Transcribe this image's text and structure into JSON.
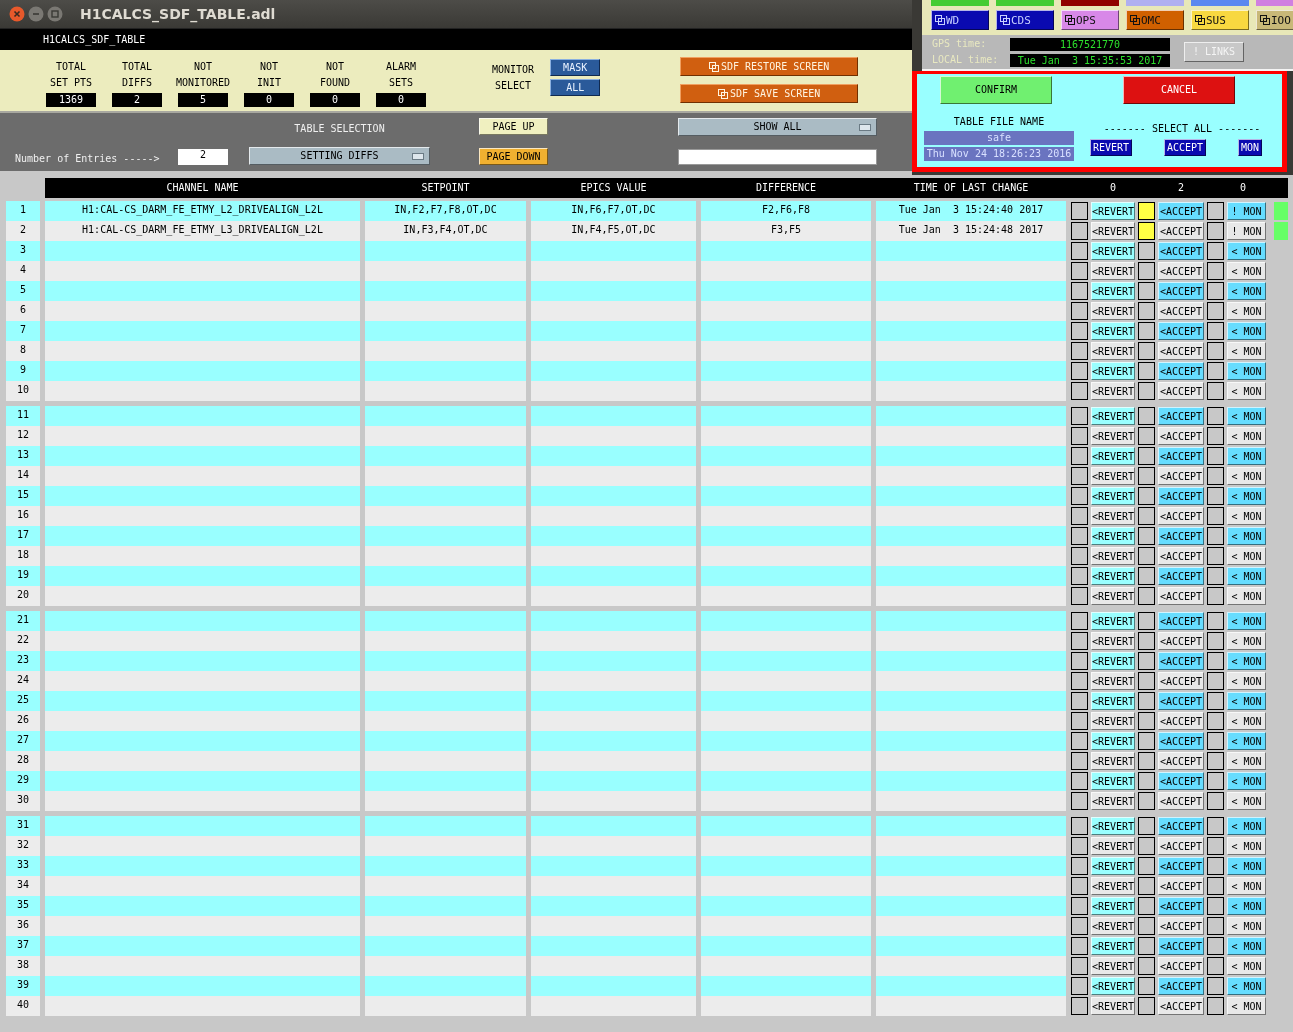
{
  "window": {
    "title": "H1CALCS_SDF_TABLE.adl"
  },
  "screen_title": "H1CALCS_SDF_TABLE",
  "stats": [
    {
      "label": [
        "TOTAL",
        "SET PTS"
      ],
      "value": "1369"
    },
    {
      "label": [
        "TOTAL",
        "DIFFS"
      ],
      "value": "2"
    },
    {
      "label": [
        "NOT",
        "MONITORED"
      ],
      "value": "5"
    },
    {
      "label": [
        "NOT",
        "INIT"
      ],
      "value": "0"
    },
    {
      "label": [
        "NOT",
        "FOUND"
      ],
      "value": "0"
    },
    {
      "label": [
        "ALARM",
        "SETS"
      ],
      "value": "0"
    }
  ],
  "monitor_select": {
    "label": [
      "MONITOR",
      "SELECT"
    ],
    "buttons": [
      "MASK",
      "ALL"
    ]
  },
  "sdf_buttons": [
    "SDF RESTORE SCREEN",
    "SDF SAVE SCREEN"
  ],
  "entries": {
    "label": "Number of Entries ----->",
    "value": "2"
  },
  "table_selection": {
    "label": "TABLE SELECTION",
    "value": "SETTING DIFFS"
  },
  "paging": [
    {
      "label": "PAGE UP",
      "kind": "up"
    },
    {
      "label": "PAGE DOWN",
      "kind": "down"
    }
  ],
  "show_menu": {
    "value": "SHOW ALL"
  },
  "displays": {
    "cut_buttons": [
      {
        "color": "#44cc33"
      },
      {
        "color": "#44cc33"
      },
      {
        "color": "#900000"
      },
      {
        "color": "#b0b0f0"
      },
      {
        "color": "#5a88f0"
      },
      {
        "color": "#d080e0"
      }
    ],
    "buttons": [
      {
        "label": "WD",
        "color": "#0a0ab0"
      },
      {
        "label": "CDS",
        "color": "#0a0ab0"
      },
      {
        "label": "OPS",
        "color": "#d888e8"
      },
      {
        "label": "OMC",
        "color": "#d06000"
      },
      {
        "label": "SUS",
        "color": "#f8d840"
      },
      {
        "label": "IOO",
        "color": "#c8b878"
      }
    ]
  },
  "gps_time": {
    "label": "GPS time:",
    "value": "1167521770"
  },
  "local_time": {
    "label": "LOCAL time:",
    "value": "Tue Jan  3 15:35:53 2017"
  },
  "links_button": "! LINKS",
  "confirm_button": "CONFIRM",
  "cancel_button": "CANCEL",
  "table_file": {
    "label": "TABLE FILE NAME",
    "name": "safe",
    "date": "Thu Nov 24 18:26:23 2016"
  },
  "select_all": {
    "label": "------- SELECT ALL -------",
    "buttons": [
      "REVERT",
      "ACCEPT",
      "MON"
    ]
  },
  "table": {
    "columns": [
      "CHANNEL NAME",
      "SETPOINT",
      "EPICS VALUE",
      "DIFFERENCE",
      "TIME OF LAST CHANGE"
    ],
    "counts": [
      "0",
      "2",
      "0"
    ],
    "rows": [
      {
        "number": "1",
        "channel": "H1:CAL-CS_DARM_FE_ETMY_L2_DRIVEALIGN_L2L",
        "setpoint": "IN,F2,F7,F8,OT,DC",
        "epics_value": "IN,F6,F7,OT,DC",
        "difference": "F2,F6,F8",
        "time": "Tue Jan  3 15:24:40 2017",
        "revert": {
          "label": "<REVERT",
          "checked": false
        },
        "accept": {
          "label": "<ACCEPT",
          "checked": true
        },
        "mon": {
          "label": "! MON",
          "checked": false
        },
        "changed": true
      },
      {
        "number": "2",
        "channel": "H1:CAL-CS_DARM_FE_ETMY_L3_DRIVEALIGN_L2L",
        "setpoint": "IN,F3,F4,OT,DC",
        "epics_value": "IN,F4,F5,OT,DC",
        "difference": "F3,F5",
        "time": "Tue Jan  3 15:24:48 2017",
        "revert": {
          "label": "<REVERT",
          "checked": false
        },
        "accept": {
          "label": "<ACCEPT",
          "checked": true
        },
        "mon": {
          "label": "! MON",
          "checked": false
        },
        "changed": true
      },
      {
        "number": "3",
        "revert": {
          "label": "<REVERT",
          "checked": false
        },
        "accept": {
          "label": "<ACCEPT",
          "checked": false
        },
        "mon": {
          "label": "< MON",
          "checked": false
        },
        "changed": false
      },
      {
        "number": "4",
        "revert": {
          "label": "<REVERT",
          "checked": false
        },
        "accept": {
          "label": "<ACCEPT",
          "checked": false
        },
        "mon": {
          "label": "< MON",
          "checked": false
        },
        "changed": false
      },
      {
        "number": "5",
        "revert": {
          "label": "<REVERT",
          "checked": false
        },
        "accept": {
          "label": "<ACCEPT",
          "checked": false
        },
        "mon": {
          "label": "< MON",
          "checked": false
        },
        "changed": false
      },
      {
        "number": "6",
        "revert": {
          "label": "<REVERT",
          "checked": false
        },
        "accept": {
          "label": "<ACCEPT",
          "checked": false
        },
        "mon": {
          "label": "< MON",
          "checked": false
        },
        "changed": false
      },
      {
        "number": "7",
        "revert": {
          "label": "<REVERT",
          "checked": false
        },
        "accept": {
          "label": "<ACCEPT",
          "checked": false
        },
        "mon": {
          "label": "< MON",
          "checked": false
        },
        "changed": false
      },
      {
        "number": "8",
        "revert": {
          "label": "<REVERT",
          "checked": false
        },
        "accept": {
          "label": "<ACCEPT",
          "checked": false
        },
        "mon": {
          "label": "< MON",
          "checked": false
        },
        "changed": false
      },
      {
        "number": "9",
        "revert": {
          "label": "<REVERT",
          "checked": false
        },
        "accept": {
          "label": "<ACCEPT",
          "checked": false
        },
        "mon": {
          "label": "< MON",
          "checked": false
        },
        "changed": false
      },
      {
        "number": "10",
        "revert": {
          "label": "<REVERT",
          "checked": false
        },
        "accept": {
          "label": "<ACCEPT",
          "checked": false
        },
        "mon": {
          "label": "< MON",
          "checked": false
        },
        "changed": false
      },
      {
        "number": "11",
        "revert": {
          "label": "<REVERT",
          "checked": false
        },
        "accept": {
          "label": "<ACCEPT",
          "checked": false
        },
        "mon": {
          "label": "< MON",
          "checked": false
        },
        "changed": false
      },
      {
        "number": "12",
        "revert": {
          "label": "<REVERT",
          "checked": false
        },
        "accept": {
          "label": "<ACCEPT",
          "checked": false
        },
        "mon": {
          "label": "< MON",
          "checked": false
        },
        "changed": false
      },
      {
        "number": "13",
        "revert": {
          "label": "<REVERT",
          "checked": false
        },
        "accept": {
          "label": "<ACCEPT",
          "checked": false
        },
        "mon": {
          "label": "< MON",
          "checked": false
        },
        "changed": false
      },
      {
        "number": "14",
        "revert": {
          "label": "<REVERT",
          "checked": false
        },
        "accept": {
          "label": "<ACCEPT",
          "checked": false
        },
        "mon": {
          "label": "< MON",
          "checked": false
        },
        "changed": false
      },
      {
        "number": "15",
        "revert": {
          "label": "<REVERT",
          "checked": false
        },
        "accept": {
          "label": "<ACCEPT",
          "checked": false
        },
        "mon": {
          "label": "< MON",
          "checked": false
        },
        "changed": false
      },
      {
        "number": "16",
        "revert": {
          "label": "<REVERT",
          "checked": false
        },
        "accept": {
          "label": "<ACCEPT",
          "checked": false
        },
        "mon": {
          "label": "< MON",
          "checked": false
        },
        "changed": false
      },
      {
        "number": "17",
        "revert": {
          "label": "<REVERT",
          "checked": false
        },
        "accept": {
          "label": "<ACCEPT",
          "checked": false
        },
        "mon": {
          "label": "< MON",
          "checked": false
        },
        "changed": false
      },
      {
        "number": "18",
        "revert": {
          "label": "<REVERT",
          "checked": false
        },
        "accept": {
          "label": "<ACCEPT",
          "checked": false
        },
        "mon": {
          "label": "< MON",
          "checked": false
        },
        "changed": false
      },
      {
        "number": "19",
        "revert": {
          "label": "<REVERT",
          "checked": false
        },
        "accept": {
          "label": "<ACCEPT",
          "checked": false
        },
        "mon": {
          "label": "< MON",
          "checked": false
        },
        "changed": false
      },
      {
        "number": "20",
        "revert": {
          "label": "<REVERT",
          "checked": false
        },
        "accept": {
          "label": "<ACCEPT",
          "checked": false
        },
        "mon": {
          "label": "< MON",
          "checked": false
        },
        "changed": false
      },
      {
        "number": "21",
        "revert": {
          "label": "<REVERT",
          "checked": false
        },
        "accept": {
          "label": "<ACCEPT",
          "checked": false
        },
        "mon": {
          "label": "< MON",
          "checked": false
        },
        "changed": false
      },
      {
        "number": "22",
        "revert": {
          "label": "<REVERT",
          "checked": false
        },
        "accept": {
          "label": "<ACCEPT",
          "checked": false
        },
        "mon": {
          "label": "< MON",
          "checked": false
        },
        "changed": false
      },
      {
        "number": "23",
        "revert": {
          "label": "<REVERT",
          "checked": false
        },
        "accept": {
          "label": "<ACCEPT",
          "checked": false
        },
        "mon": {
          "label": "< MON",
          "checked": false
        },
        "changed": false
      },
      {
        "number": "24",
        "revert": {
          "label": "<REVERT",
          "checked": false
        },
        "accept": {
          "label": "<ACCEPT",
          "checked": false
        },
        "mon": {
          "label": "< MON",
          "checked": false
        },
        "changed": false
      },
      {
        "number": "25",
        "revert": {
          "label": "<REVERT",
          "checked": false
        },
        "accept": {
          "label": "<ACCEPT",
          "checked": false
        },
        "mon": {
          "label": "< MON",
          "checked": false
        },
        "changed": false
      },
      {
        "number": "26",
        "revert": {
          "label": "<REVERT",
          "checked": false
        },
        "accept": {
          "label": "<ACCEPT",
          "checked": false
        },
        "mon": {
          "label": "< MON",
          "checked": false
        },
        "changed": false
      },
      {
        "number": "27",
        "revert": {
          "label": "<REVERT",
          "checked": false
        },
        "accept": {
          "label": "<ACCEPT",
          "checked": false
        },
        "mon": {
          "label": "< MON",
          "checked": false
        },
        "changed": false
      },
      {
        "number": "28",
        "revert": {
          "label": "<REVERT",
          "checked": false
        },
        "accept": {
          "label": "<ACCEPT",
          "checked": false
        },
        "mon": {
          "label": "< MON",
          "checked": false
        },
        "changed": false
      },
      {
        "number": "29",
        "revert": {
          "label": "<REVERT",
          "checked": false
        },
        "accept": {
          "label": "<ACCEPT",
          "checked": false
        },
        "mon": {
          "label": "< MON",
          "checked": false
        },
        "changed": false
      },
      {
        "number": "30",
        "revert": {
          "label": "<REVERT",
          "checked": false
        },
        "accept": {
          "label": "<ACCEPT",
          "checked": false
        },
        "mon": {
          "label": "< MON",
          "checked": false
        },
        "changed": false
      },
      {
        "number": "31",
        "revert": {
          "label": "<REVERT",
          "checked": false
        },
        "accept": {
          "label": "<ACCEPT",
          "checked": false
        },
        "mon": {
          "label": "< MON",
          "checked": false
        },
        "changed": false
      },
      {
        "number": "32",
        "revert": {
          "label": "<REVERT",
          "checked": false
        },
        "accept": {
          "label": "<ACCEPT",
          "checked": false
        },
        "mon": {
          "label": "< MON",
          "checked": false
        },
        "changed": false
      },
      {
        "number": "33",
        "revert": {
          "label": "<REVERT",
          "checked": false
        },
        "accept": {
          "label": "<ACCEPT",
          "checked": false
        },
        "mon": {
          "label": "< MON",
          "checked": false
        },
        "changed": false
      },
      {
        "number": "34",
        "revert": {
          "label": "<REVERT",
          "checked": false
        },
        "accept": {
          "label": "<ACCEPT",
          "checked": false
        },
        "mon": {
          "label": "< MON",
          "checked": false
        },
        "changed": false
      },
      {
        "number": "35",
        "revert": {
          "label": "<REVERT",
          "checked": false
        },
        "accept": {
          "label": "<ACCEPT",
          "checked": false
        },
        "mon": {
          "label": "< MON",
          "checked": false
        },
        "changed": false
      },
      {
        "number": "36",
        "revert": {
          "label": "<REVERT",
          "checked": false
        },
        "accept": {
          "label": "<ACCEPT",
          "checked": false
        },
        "mon": {
          "label": "< MON",
          "checked": false
        },
        "changed": false
      },
      {
        "number": "37",
        "revert": {
          "label": "<REVERT",
          "checked": false
        },
        "accept": {
          "label": "<ACCEPT",
          "checked": false
        },
        "mon": {
          "label": "< MON",
          "checked": false
        },
        "changed": false
      },
      {
        "number": "38",
        "revert": {
          "label": "<REVERT",
          "checked": false
        },
        "accept": {
          "label": "<ACCEPT",
          "checked": false
        },
        "mon": {
          "label": "< MON",
          "checked": false
        },
        "changed": false
      },
      {
        "number": "39",
        "revert": {
          "label": "<REVERT",
          "checked": false
        },
        "accept": {
          "label": "<ACCEPT",
          "checked": false
        },
        "mon": {
          "label": "< MON",
          "checked": false
        },
        "changed": false
      },
      {
        "number": "40",
        "revert": {
          "label": "<REVERT",
          "checked": false
        },
        "accept": {
          "label": "<ACCEPT",
          "checked": false
        },
        "mon": {
          "label": "< MON",
          "checked": false
        },
        "changed": false
      }
    ]
  }
}
